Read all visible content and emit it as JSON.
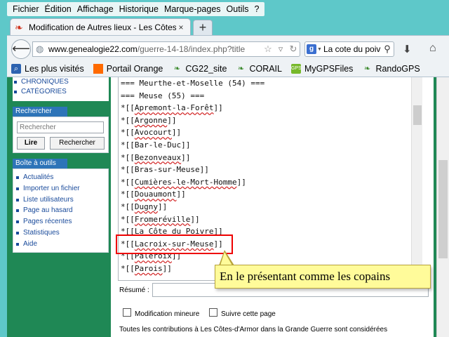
{
  "menu": [
    "Fichier",
    "Édition",
    "Affichage",
    "Historique",
    "Marque-pages",
    "Outils",
    "?"
  ],
  "tab": {
    "title": "Modification de Autres lieux - Les Côtes-...",
    "close": "×",
    "newtab": "+"
  },
  "nav": {
    "url_host": "www.genealogie22.com",
    "url_path": "/guerre-14-18/index.php?title",
    "search_value": "La cote du poivre"
  },
  "bookmarks": [
    {
      "label": "Les plus visités",
      "icon": "bookmark-icon"
    },
    {
      "label": "Portail Orange",
      "icon": "orange-icon"
    },
    {
      "label": "CG22_site",
      "icon": "cg22-icon"
    },
    {
      "label": "CORAIL",
      "icon": "corail-icon"
    },
    {
      "label": "MyGPSFiles",
      "icon": "mygps-icon"
    },
    {
      "label": "RandoGPS",
      "icon": "rando-icon"
    }
  ],
  "sidebar": {
    "links": [
      "CHRONIQUES",
      "CATÉGORIES"
    ],
    "search_title": "Rechercher",
    "search_placeholder": "Rechercher",
    "btn_go": "Lire",
    "btn_search": "Rechercher",
    "tools_title": "Boîte à outils",
    "tools": [
      "Actualités",
      "Importer un fichier",
      "Liste utilisateurs",
      "Page au hasard",
      "Pages récentes",
      "Statistiques",
      "Aide"
    ]
  },
  "editor": {
    "lines": [
      "=== Meurthe-et-Moselle (54) ===",
      "",
      "=== Meuse (55) ===",
      "*[[Apremont-la-Forêt]]",
      "*[[Argonne]]",
      "*[[Avocourt]]",
      "*[[Bar-le-Duc]]",
      "*[[Bezonveaux]]",
      "*[[Bras-sur-Meuse]]",
      "*[[Cumières-le-Mort-Homme]]",
      "*[[Douaumont]]",
      "*[[Dugny]]",
      "*[[Fromeréville]]",
      "*[[La Côte du Poivre]]",
      "*[[Lacroix-sur-Meuse]]",
      "*[[Paleroix]]",
      "*[[Parois]]"
    ],
    "summary_label": "Résumé :",
    "minor_label": "Modification mineure",
    "watch_label": "Suivre cette page",
    "footnote": "Toutes les contributions à Les Côtes-d'Armor dans la Grande Guerre sont considérées"
  },
  "callout": "En le présentant comme les copains"
}
